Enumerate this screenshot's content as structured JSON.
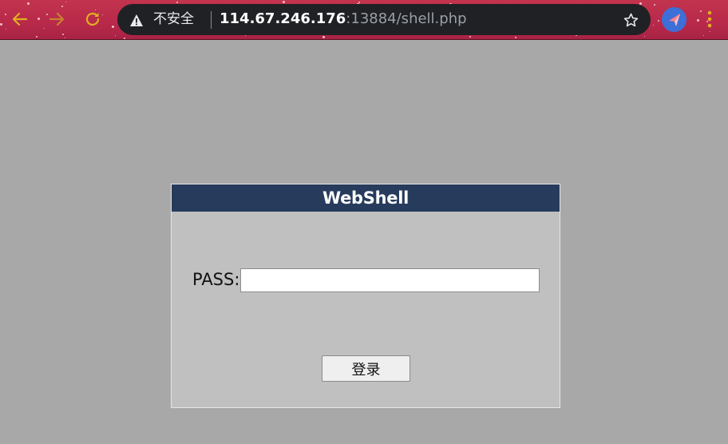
{
  "browser": {
    "security_label": "不安全",
    "url_host": "114.67.246.176",
    "url_rest": ":13884/shell.php",
    "icons": {
      "back": "arrow-left-icon",
      "forward": "arrow-right-icon",
      "reload": "reload-icon",
      "security": "warning-triangle-icon",
      "bookmark": "star-icon",
      "profile": "profile-avatar-icon",
      "menu": "kebab-menu-icon"
    },
    "colors": {
      "toolbar": "#b8294a",
      "omnibox": "#202124",
      "nav_icons": "#d9b020",
      "profile": "#3d6fd8"
    }
  },
  "page": {
    "background": "#a8a8a8",
    "login": {
      "title": "WebShell",
      "pass_label": "PASS:",
      "pass_value": "",
      "submit_label": "登录",
      "header_color": "#273b5c",
      "panel_color": "#c0c0c0"
    }
  }
}
